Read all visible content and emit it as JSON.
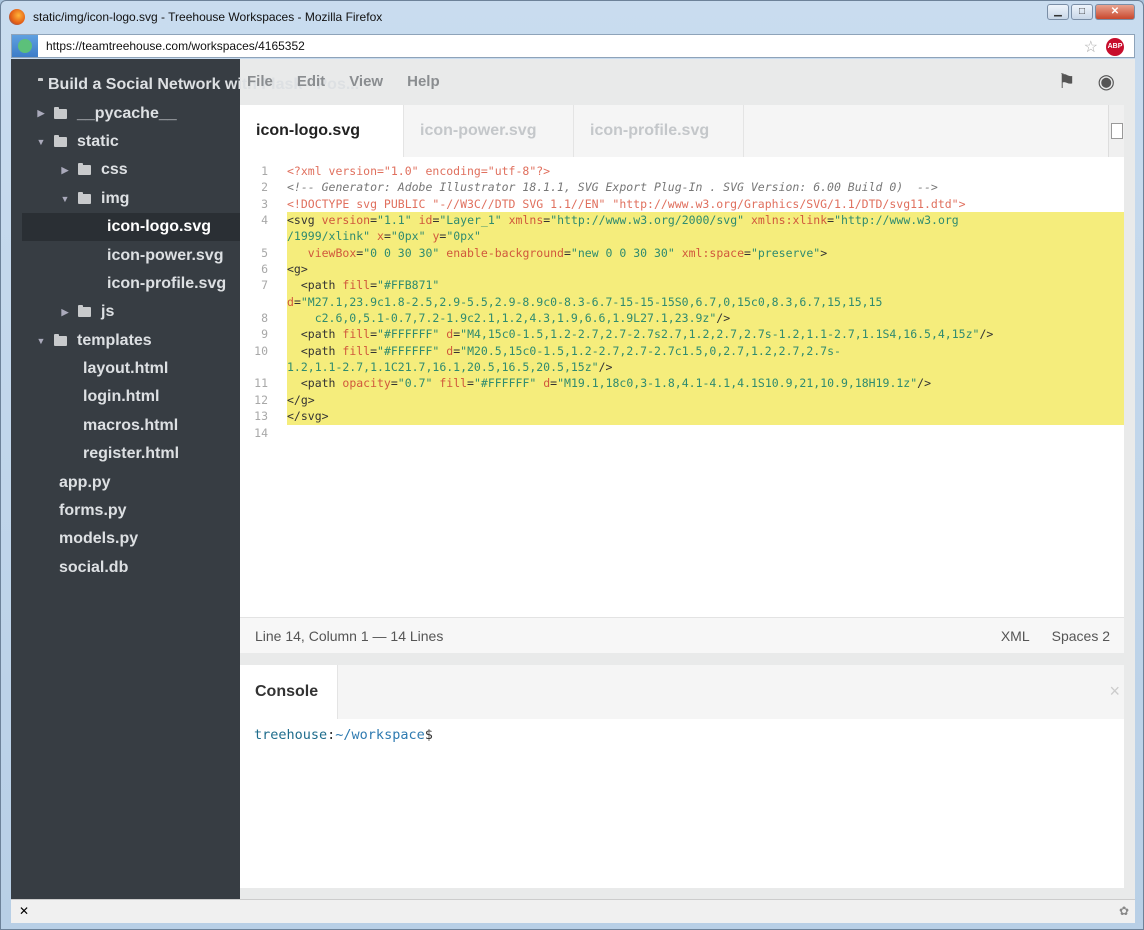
{
  "window": {
    "title": "static/img/icon-logo.svg - Treehouse Workspaces - Mozilla Firefox",
    "url": "https://teamtreehouse.com/workspaces/4165352"
  },
  "menu": [
    "File",
    "Edit",
    "View",
    "Help"
  ],
  "sidebar": {
    "items": [
      {
        "label": "Build a Social Network with Flask - Pos...",
        "indent": 0,
        "arrow": "",
        "folder": true
      },
      {
        "label": "__pycache__",
        "indent": 1,
        "arrow": "right",
        "folder": true
      },
      {
        "label": "static",
        "indent": 1,
        "arrow": "down",
        "folder": true
      },
      {
        "label": "css",
        "indent": 2,
        "arrow": "right",
        "folder": true
      },
      {
        "label": "img",
        "indent": 2,
        "arrow": "down",
        "folder": true
      },
      {
        "label": "icon-logo.svg",
        "indent": 3,
        "selected": true
      },
      {
        "label": "icon-power.svg",
        "indent": 3
      },
      {
        "label": "icon-profile.svg",
        "indent": 3
      },
      {
        "label": "js",
        "indent": 2,
        "arrow": "right",
        "folder": true
      },
      {
        "label": "templates",
        "indent": 1,
        "arrow": "down",
        "folder": true
      },
      {
        "label": "layout.html",
        "indent": 2
      },
      {
        "label": "login.html",
        "indent": 2
      },
      {
        "label": "macros.html",
        "indent": 2
      },
      {
        "label": "register.html",
        "indent": 2
      },
      {
        "label": "app.py",
        "indent": 1
      },
      {
        "label": "forms.py",
        "indent": 1
      },
      {
        "label": "models.py",
        "indent": 1
      },
      {
        "label": "social.db",
        "indent": 1
      }
    ]
  },
  "tabs": [
    {
      "label": "icon-logo.svg",
      "active": true
    },
    {
      "label": "icon-power.svg"
    },
    {
      "label": "icon-profile.svg"
    }
  ],
  "code": [
    {
      "n": "1",
      "t": [
        [
          "meta",
          "<?xml version=\"1.0\" encoding=\"utf-8\"?>"
        ]
      ]
    },
    {
      "n": "2",
      "t": [
        [
          "com",
          "<!-- Generator: Adobe Illustrator 18.1.1, SVG Export Plug-In . SVG Version: 6.00 Build 0)  -->"
        ]
      ]
    },
    {
      "n": "3",
      "t": [
        [
          "meta",
          "<!DOCTYPE svg PUBLIC \"-//W3C//DTD SVG 1.1//EN\" \"http://www.w3.org/Graphics/SVG/1.1/DTD/svg11.dtd\">"
        ]
      ]
    },
    {
      "n": "4",
      "hl": true,
      "t": [
        [
          "tag",
          "<svg "
        ],
        [
          "attr",
          "version"
        ],
        [
          "tag",
          "="
        ],
        [
          "str",
          "\"1.1\" "
        ],
        [
          "attr",
          "id"
        ],
        [
          "tag",
          "="
        ],
        [
          "str",
          "\"Layer_1\" "
        ],
        [
          "attr",
          "xmlns"
        ],
        [
          "tag",
          "="
        ],
        [
          "str",
          "\"http://www.w3.org/2000/svg\" "
        ],
        [
          "attr",
          "xmlns:xlink"
        ],
        [
          "tag",
          "="
        ],
        [
          "str",
          "\"http://www.w3.org"
        ]
      ]
    },
    {
      "n": "",
      "hl": true,
      "t": [
        [
          "str",
          "/1999/xlink\" "
        ],
        [
          "attr",
          "x"
        ],
        [
          "tag",
          "="
        ],
        [
          "str",
          "\"0px\" "
        ],
        [
          "attr",
          "y"
        ],
        [
          "tag",
          "="
        ],
        [
          "str",
          "\"0px\""
        ]
      ]
    },
    {
      "n": "5",
      "hl": true,
      "t": [
        [
          "tag",
          "   "
        ],
        [
          "attr",
          "viewBox"
        ],
        [
          "tag",
          "="
        ],
        [
          "str",
          "\"0 0 30 30\" "
        ],
        [
          "attr",
          "enable-background"
        ],
        [
          "tag",
          "="
        ],
        [
          "str",
          "\"new 0 0 30 30\" "
        ],
        [
          "attr",
          "xml:space"
        ],
        [
          "tag",
          "="
        ],
        [
          "str",
          "\"preserve\""
        ],
        [
          "tag",
          ">"
        ]
      ]
    },
    {
      "n": "6",
      "hl": true,
      "t": [
        [
          "tag",
          "<g>"
        ]
      ]
    },
    {
      "n": "7",
      "hl": true,
      "t": [
        [
          "tag",
          "  <path "
        ],
        [
          "attr",
          "fill"
        ],
        [
          "tag",
          "="
        ],
        [
          "str",
          "\"#FFB871\""
        ]
      ]
    },
    {
      "n": "",
      "hl": true,
      "t": [
        [
          "attr",
          "d"
        ],
        [
          "tag",
          "="
        ],
        [
          "str",
          "\"M27.1,23.9c1.8-2.5,2.9-5.5,2.9-8.9c0-8.3-6.7-15-15-15S0,6.7,0,15c0,8.3,6.7,15,15,15"
        ]
      ]
    },
    {
      "n": "8",
      "hl": true,
      "t": [
        [
          "str",
          "    c2.6,0,5.1-0.7,7.2-1.9c2.1,1.2,4.3,1.9,6.6,1.9L27.1,23.9z\""
        ],
        [
          "tag",
          "/>"
        ]
      ]
    },
    {
      "n": "9",
      "hl": true,
      "t": [
        [
          "tag",
          "  <path "
        ],
        [
          "attr",
          "fill"
        ],
        [
          "tag",
          "="
        ],
        [
          "str",
          "\"#FFFFFF\" "
        ],
        [
          "attr",
          "d"
        ],
        [
          "tag",
          "="
        ],
        [
          "str",
          "\"M4,15c0-1.5,1.2-2.7,2.7-2.7s2.7,1.2,2.7,2.7s-1.2,1.1-2.7,1.1S4,16.5,4,15z\""
        ],
        [
          "tag",
          "/>"
        ]
      ]
    },
    {
      "n": "10",
      "hl": true,
      "t": [
        [
          "tag",
          "  <path "
        ],
        [
          "attr",
          "fill"
        ],
        [
          "tag",
          "="
        ],
        [
          "str",
          "\"#FFFFFF\" "
        ],
        [
          "attr",
          "d"
        ],
        [
          "tag",
          "="
        ],
        [
          "str",
          "\"M20.5,15c0-1.5,1.2-2.7,2.7-2.7c1.5,0,2.7,1.2,2.7,2.7s-"
        ]
      ]
    },
    {
      "n": "",
      "hl": true,
      "t": [
        [
          "str",
          "1.2,1.1-2.7,1.1C21.7,16.1,20.5,16.5,20.5,15z\""
        ],
        [
          "tag",
          "/>"
        ]
      ]
    },
    {
      "n": "11",
      "hl": true,
      "t": [
        [
          "tag",
          "  <path "
        ],
        [
          "attr",
          "opacity"
        ],
        [
          "tag",
          "="
        ],
        [
          "str",
          "\"0.7\" "
        ],
        [
          "attr",
          "fill"
        ],
        [
          "tag",
          "="
        ],
        [
          "str",
          "\"#FFFFFF\" "
        ],
        [
          "attr",
          "d"
        ],
        [
          "tag",
          "="
        ],
        [
          "str",
          "\"M19.1,18c0,3-1.8,4.1-4.1,4.1S10.9,21,10.9,18H19.1z\""
        ],
        [
          "tag",
          "/>"
        ]
      ]
    },
    {
      "n": "12",
      "hl": true,
      "t": [
        [
          "tag",
          "</g>"
        ]
      ]
    },
    {
      "n": "13",
      "hl": true,
      "t": [
        [
          "tag",
          "</svg>"
        ]
      ]
    },
    {
      "n": "14",
      "t": []
    }
  ],
  "status": {
    "position": "Line 14, Column 1 — 14 Lines",
    "mode": "XML",
    "indent": "Spaces 2"
  },
  "console": {
    "tab": "Console",
    "close": "×",
    "user": "treehouse",
    "path": "~/workspace",
    "dollar": "$"
  },
  "colors": {
    "sidebar": "#373d43",
    "highlight": "#f5ed7c",
    "attr": "#d0583c",
    "string": "#2f8b6f"
  }
}
